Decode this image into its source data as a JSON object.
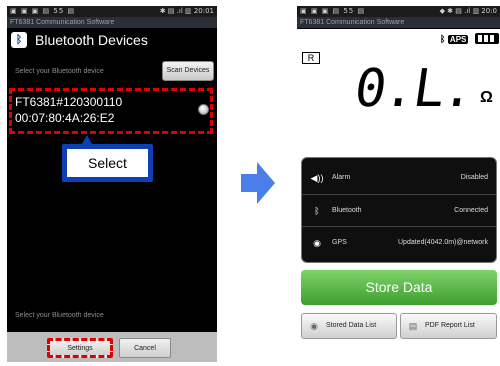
{
  "left_phone": {
    "status_bar": {
      "left": "▣ ▣ ▣ ▤ 55 ▤",
      "right": "✱ ▤ .ıl ▥ 20:01"
    },
    "app_title": "FT6381 Communication Software",
    "screen_title": "Bluetooth Devices",
    "select_hint": "Select your Bluetooth device",
    "scan_button": "Scan Devices",
    "device": {
      "name": "FT6381#120300110",
      "address": "00:07:80:4A:26:E2"
    },
    "callout_label": "Select",
    "select_hint_bottom": "Select your Bluetooth device",
    "settings_button": "Settings",
    "cancel_button": "Cancel"
  },
  "right_phone": {
    "status_bar": {
      "left": "▣ ▣ ▣ ▤ 55 ▤",
      "right": "◆ ✱ ▤ .ıl ▥ 20:0"
    },
    "app_title": "FT6381 Communication Software",
    "aps_label": "APS",
    "range_indicator": "R",
    "reading": "0.L.",
    "unit": "Ω",
    "rows": [
      {
        "label": "Alarm",
        "value": "Disabled"
      },
      {
        "label": "Bluetooth",
        "value": "Connected"
      },
      {
        "label": "GPS",
        "value": "Updated(4042.0m)@network"
      }
    ],
    "store_button": "Store Data",
    "stored_data_button": "Stored Data List",
    "pdf_button": "PDF Report List"
  }
}
